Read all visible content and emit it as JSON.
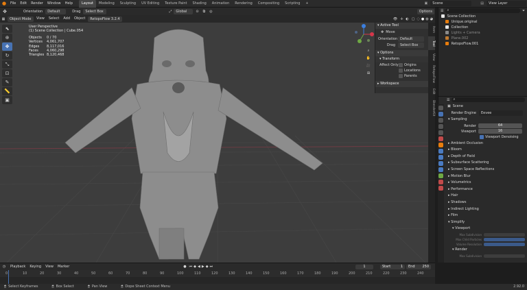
{
  "app": {
    "menu": [
      "File",
      "Edit",
      "Render",
      "Window",
      "Help"
    ],
    "workspaces": [
      "Layout",
      "Modeling",
      "Sculpting",
      "UV Editing",
      "Texture Paint",
      "Shading",
      "Animation",
      "Rendering",
      "Compositing",
      "Scripting"
    ],
    "active_workspace": "Layout",
    "scene_label": "Scene",
    "view_layer_label": "View Layer"
  },
  "viewport_header": {
    "orientation_label": "Orientation",
    "orientation_value": "Default",
    "drag_label": "Drag",
    "drag_value": "Select Box",
    "transform_space": "Global",
    "options_label": "Options"
  },
  "editor_header": {
    "mode": "Object Mode",
    "menus": [
      "View",
      "Select",
      "Add",
      "Object"
    ],
    "addon_label": "RetopoFlow 3.2.4"
  },
  "viewport_info": {
    "view_name": "User Perspective",
    "collection_line": "(1) Scene Collection | Cube.054",
    "stats": [
      {
        "key": "Objects",
        "value": "0 / 70"
      },
      {
        "key": "Vertices",
        "value": "4,061,707"
      },
      {
        "key": "Edges",
        "value": "8,117,016"
      },
      {
        "key": "Faces",
        "value": "4,060,298"
      },
      {
        "key": "Triangles",
        "value": "8,120,468"
      }
    ]
  },
  "sidebar_panel": {
    "active_tool_title": "Active Tool",
    "tool_name": "Move",
    "orientation_label": "Orientation",
    "orientation_value": "Default",
    "drag_label": "Drag",
    "drag_value": "Select Box",
    "options_title": "Options",
    "transform_title": "Transform",
    "affect_only_label": "Affect Only",
    "affect_options": [
      "Origins",
      "Locations",
      "Parents"
    ],
    "workspace_title": "Workspace",
    "tabs": [
      "Item",
      "Tool",
      "View",
      "RetopoFlow",
      "Edit",
      "BlenderKit"
    ]
  },
  "outliner": {
    "title": "Scene Collection",
    "items": [
      {
        "name": "Unique.original"
      },
      {
        "name": "Collection"
      },
      {
        "name": "Lights + Camera"
      },
      {
        "name": "Plane.002"
      },
      {
        "name": "RetopoFlow.001"
      }
    ]
  },
  "properties": {
    "scene_name": "Scene",
    "render_engine_label": "Render Engine",
    "render_engine_value": "Eevee",
    "sampling_title": "Sampling",
    "render_label": "Render",
    "render_value": "64",
    "viewport_label": "Viewport",
    "viewport_value": "16",
    "viewport_denoising": "Viewport Denoising",
    "sections": [
      "Ambient Occlusion",
      "Bloom",
      "Depth of Field",
      "Subsurface Scattering",
      "Screen Space Reflections",
      "Motion Blur",
      "Volumetrics",
      "Performance",
      "Hair",
      "Shadows",
      "Indirect Lighting",
      "Film",
      "Simplify"
    ],
    "simplify_viewport_title": "Viewport",
    "simplify_viewport_fields": [
      "Max Subdivision",
      "Max Child Particles",
      "Volume Resolution"
    ],
    "simplify_render_title": "Render",
    "simplify_render_fields": [
      "Max Subdivision",
      "Max Child Particles"
    ]
  },
  "timeline": {
    "menus": [
      "Playback",
      "Keying",
      "View",
      "Marker"
    ],
    "current_frame": "1",
    "start_label": "Start",
    "start_value": "1",
    "end_label": "End",
    "end_value": "250",
    "ticks": [
      "0",
      "10",
      "20",
      "30",
      "40",
      "50",
      "60",
      "70",
      "80",
      "90",
      "100",
      "110",
      "120",
      "130",
      "140",
      "150",
      "160",
      "170",
      "180",
      "190",
      "200",
      "210",
      "220",
      "230",
      "240"
    ]
  },
  "status_bar": {
    "items": [
      "Select Keyframes",
      "Box Select",
      "Pan View",
      "Dope Sheet Context Menu"
    ],
    "version": "2.92.0"
  },
  "colors": {
    "accent_blue": "#4772b3",
    "selected_row": "#334d80",
    "axis_x": "#d6364a",
    "axis_y": "#6fa844",
    "axis_z": "#3b7fe0"
  }
}
